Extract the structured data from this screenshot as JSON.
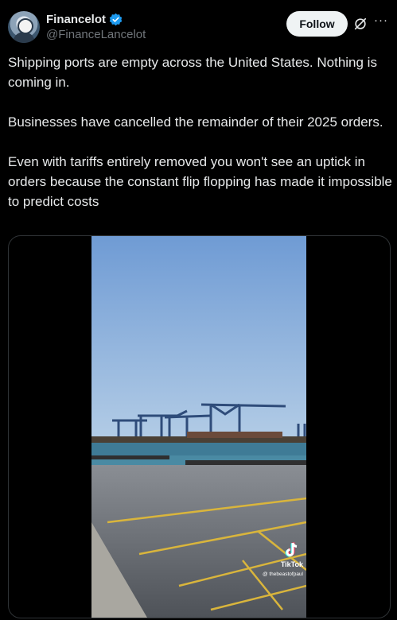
{
  "author": {
    "display_name": "Financelot",
    "handle": "@FinanceLancelot",
    "verified": true,
    "avatar_icon": "avatar-knight"
  },
  "actions": {
    "follow_label": "Follow",
    "grok_icon": "grok-icon",
    "more_icon": "more-icon"
  },
  "tweet": {
    "paragraphs": [
      "Shipping ports are empty across the United States. Nothing is coming in.",
      "Businesses have cancelled the remainder of their 2025 orders.",
      "Even with tariffs entirely removed you won't see an uptick in orders because the constant flip flopping has made it impossible to predict costs"
    ]
  },
  "media": {
    "type": "video",
    "watermark_brand": "TikTok",
    "watermark_handle": "@ thebeastofpaul"
  },
  "colors": {
    "background": "#000000",
    "text": "#e7e9ea",
    "secondary": "#71767b",
    "verified": "#1d9bf0",
    "follow_bg": "#eff3f4"
  }
}
